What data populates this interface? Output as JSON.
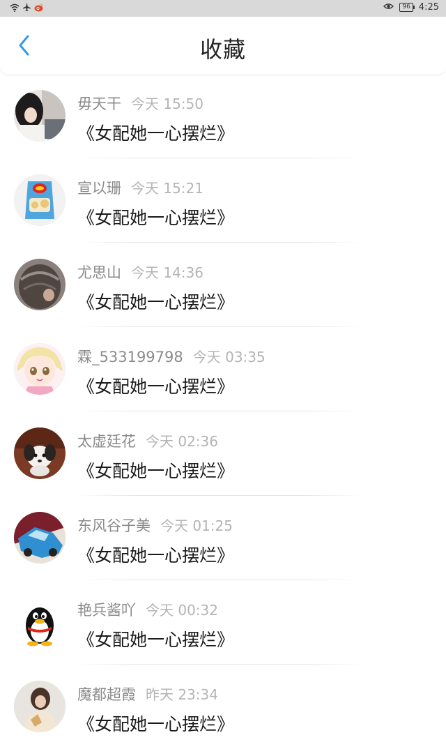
{
  "status_bar": {
    "time": "4:25",
    "battery": "96",
    "left_icons": [
      "wifi-icon",
      "airplane-icon",
      "app-notification-icon"
    ],
    "right_icons": [
      "eye-icon",
      "battery-icon"
    ]
  },
  "header": {
    "title": "收藏",
    "back_icon": "chevron-left-icon",
    "accent_color": "#2d9ce8"
  },
  "items": [
    {
      "name": "毋天干",
      "time": "今天 15:50",
      "book": "《女配她一心摆烂》",
      "avatar": "photo-girl"
    },
    {
      "name": "宣以珊",
      "time": "今天 15:21",
      "book": "《女配她一心摆烂》",
      "avatar": "chips-bag"
    },
    {
      "name": "尤思山",
      "time": "今天 14:36",
      "book": "《女配她一心摆烂》",
      "avatar": "photo-hair"
    },
    {
      "name": "霖_533199798",
      "time": "今天 03:35",
      "book": "《女配她一心摆烂》",
      "avatar": "anime-girl"
    },
    {
      "name": "太虚廷花",
      "time": "今天 02:36",
      "book": "《女配她一心摆烂》",
      "avatar": "puppy"
    },
    {
      "name": "东风谷子美",
      "time": "今天 01:25",
      "book": "《女配她一心摆烂》",
      "avatar": "blue-car"
    },
    {
      "name": "艳兵酱吖",
      "time": "今天 00:32",
      "book": "《女配她一心摆烂》",
      "avatar": "qq-penguin"
    },
    {
      "name": "魔都超霞",
      "time": "昨天 23:34",
      "book": "《女配她一心摆烂》",
      "avatar": "photo-woman"
    }
  ]
}
